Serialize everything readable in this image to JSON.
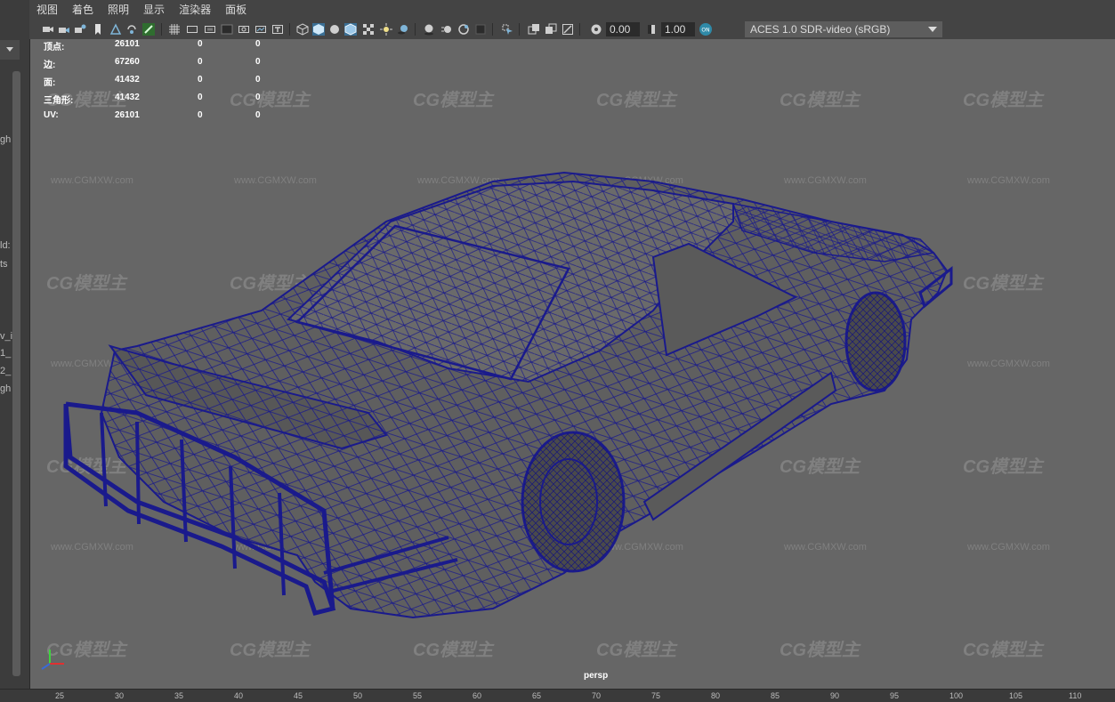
{
  "menu": [
    "视图",
    "着色",
    "照明",
    "显示",
    "渲染器",
    "面板"
  ],
  "toolbar": {
    "exposure_value": "0.00",
    "gamma_value": "1.00",
    "color_management": "ACES 1.0 SDR-video (sRGB)",
    "icons": [
      "camera-icon",
      "camera-attr-icon",
      "bookmark-icon",
      "image-plane-icon",
      "grid-icon",
      "wireframe-icon",
      "smooth-shaded-icon",
      "textured-icon",
      "lights-icon",
      "shadows-icon",
      "isolate-icon",
      "xray-icon",
      "exposure-icon",
      "gamma-icon",
      "color-management-icon"
    ]
  },
  "hud": {
    "rows": [
      {
        "label": "顶点:",
        "v1": "26101",
        "v2": "0",
        "v3": "0"
      },
      {
        "label": "边:",
        "v1": "67260",
        "v2": "0",
        "v3": "0"
      },
      {
        "label": "面:",
        "v1": "41432",
        "v2": "0",
        "v3": "0"
      },
      {
        "label": "三角形:",
        "v1": "41432",
        "v2": "0",
        "v3": "0"
      },
      {
        "label": "UV:",
        "v1": "26101",
        "v2": "0",
        "v3": "0"
      }
    ]
  },
  "viewport": {
    "camera": "persp",
    "watermark": "CG模型主",
    "watermark_url": "www.CGMXW.com",
    "wireframe_color": "#1a1a8c",
    "background_color": "#666666"
  },
  "left_fragments": [
    "gh",
    "ld:",
    "ts",
    "v_i",
    "1_",
    "2_",
    "gh"
  ],
  "ruler": [
    "25",
    "30",
    "35",
    "40",
    "45",
    "50",
    "55",
    "60",
    "65",
    "70",
    "75",
    "80",
    "85",
    "90",
    "95",
    "100",
    "105",
    "110"
  ]
}
